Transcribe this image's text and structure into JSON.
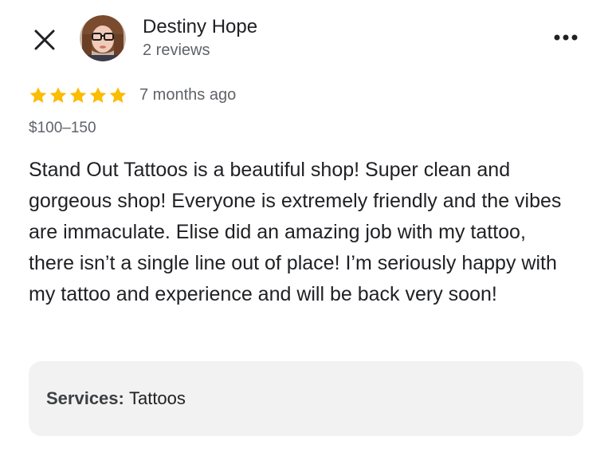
{
  "header": {
    "close_icon": "close-icon",
    "more_icon": "more-horizontal-icon",
    "reviewer": {
      "name": "Destiny Hope",
      "review_count": "2 reviews",
      "avatar_icon": "avatar-photo"
    }
  },
  "review": {
    "rating": 5,
    "rating_max": 5,
    "star_color": "#FBBC04",
    "time_ago": "7 months ago",
    "price_range": "$100–150",
    "text": "Stand Out Tattoos is a beautiful shop! Super clean and gorgeous shop! Everyone is extremely friendly and the vibes are immaculate. Elise did an amazing job with my tattoo, there isn’t a single line out of place! I’m seriously happy with my tattoo and experience and will be back very soon!"
  },
  "services": {
    "label": "Services:",
    "value": "Tattoos"
  }
}
